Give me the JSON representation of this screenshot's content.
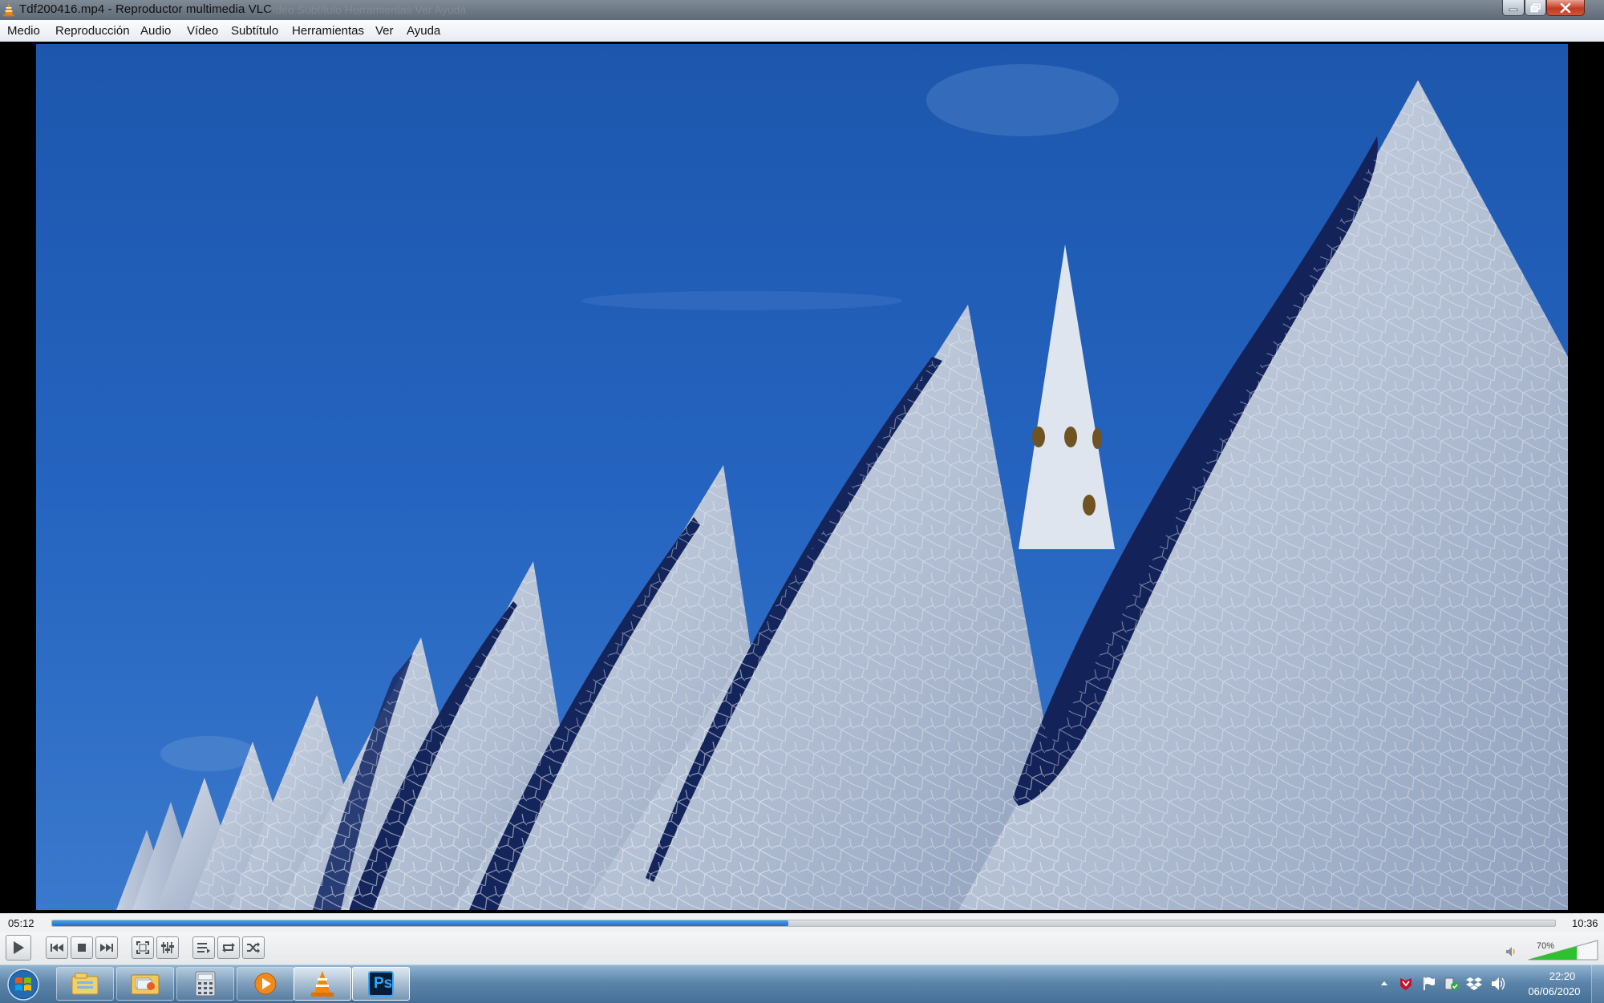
{
  "window": {
    "title": "Tdf200416.mp4 - Reproductor multimedia VLC",
    "title_echo": "Vídeo   Subtítulo   Herramientas   Ver   Ayuda"
  },
  "menu": {
    "items": [
      "Medio",
      "Reproducción",
      "Audio",
      "Vídeo",
      "Subtítulo",
      "Herramientas",
      "Ver",
      "Ayuda"
    ]
  },
  "playback": {
    "elapsed": "05:12",
    "total": "10:36",
    "progress_fraction": 0.49
  },
  "controls": {
    "buttons": [
      "play-icon",
      "previous-icon",
      "stop-icon",
      "next-icon",
      "fullscreen-icon",
      "extended-settings-icon",
      "playlist-icon",
      "loop-icon",
      "shuffle-icon"
    ]
  },
  "volume": {
    "label": "70%",
    "level_fraction": 0.7
  },
  "taskbar": {
    "apps": [
      "libraries-icon",
      "windows-explorer-icon",
      "calculator-icon",
      "media-player-icon",
      "vlc-icon",
      "photoshop-icon"
    ],
    "photoshop_label": "Ps"
  },
  "tray": {
    "icons": [
      "show-hidden-icons-icon",
      "mcafee-icon",
      "action-center-flag-icon",
      "security-icon",
      "dropbox-icon",
      "speaker-icon"
    ]
  },
  "clock": {
    "time": "22:20",
    "date": "06/06/2020"
  },
  "colors": {
    "sky_blue": "#1f5fb8",
    "seek_fill": "#2a7fd6",
    "taskbar": "#5d85aa"
  }
}
